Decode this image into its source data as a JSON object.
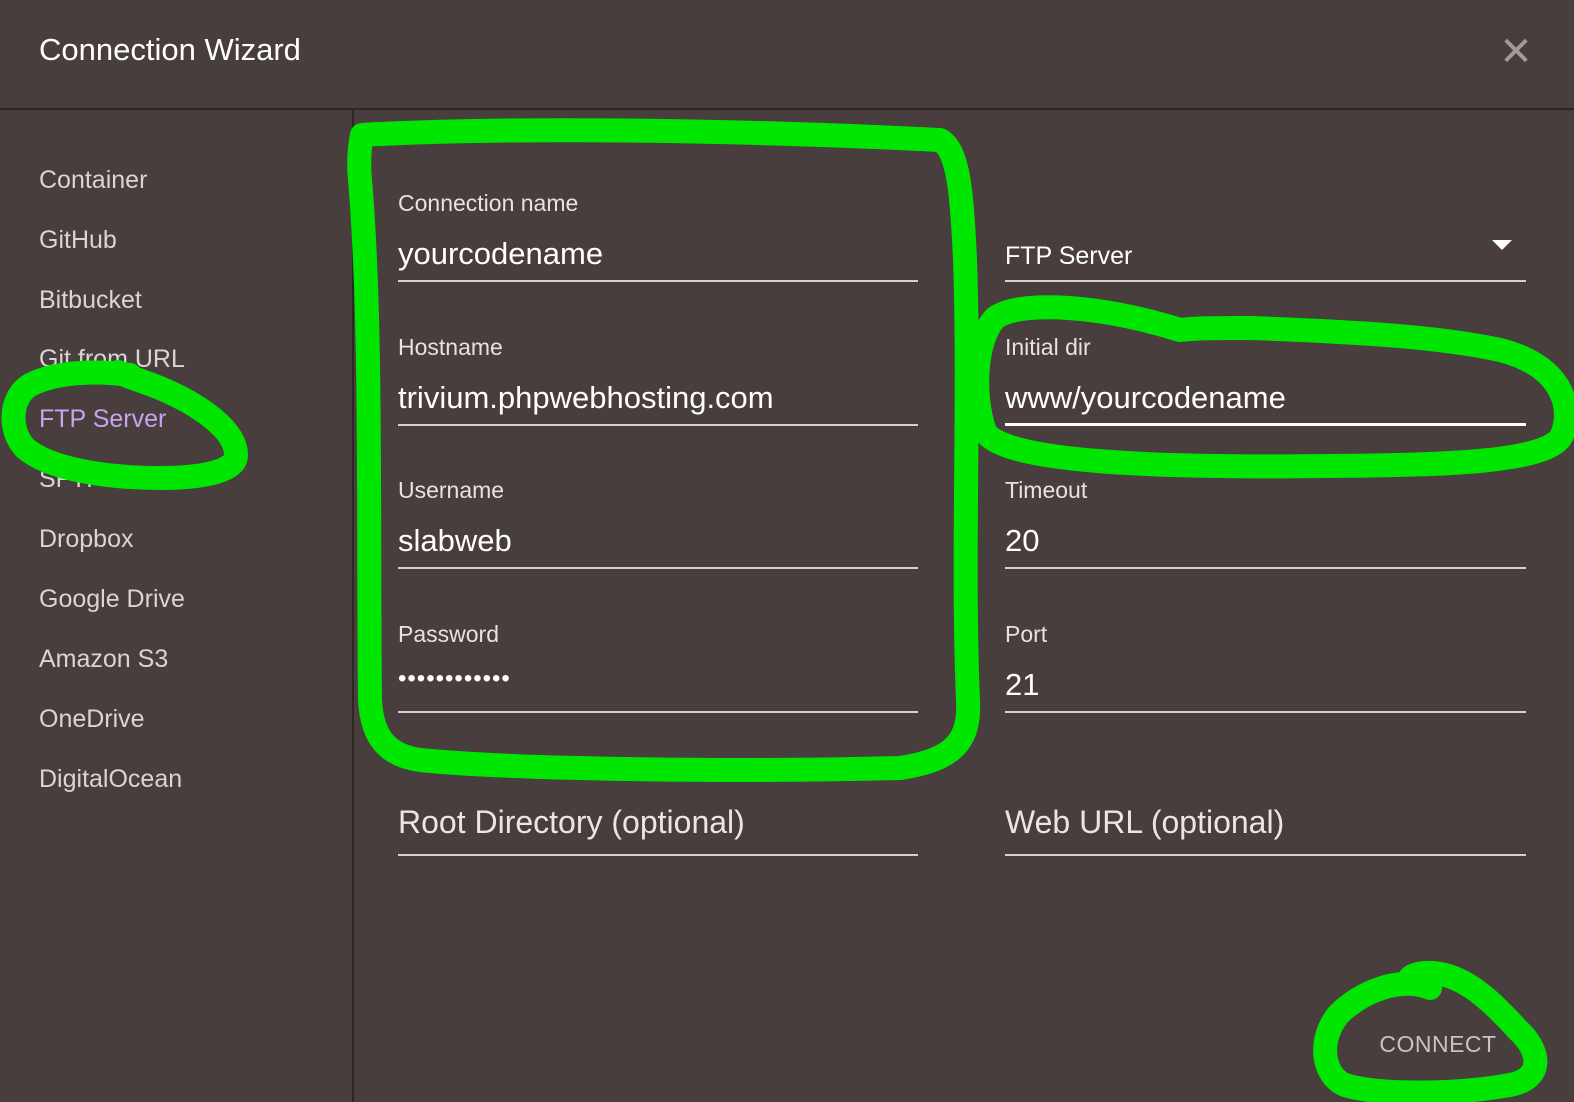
{
  "dialog": {
    "title": "Connection Wizard",
    "close_label": "✕"
  },
  "sidebar": {
    "items": [
      {
        "label": "Container"
      },
      {
        "label": "GitHub"
      },
      {
        "label": "Bitbucket"
      },
      {
        "label": "Git from URL"
      },
      {
        "label": "FTP Server",
        "active": true
      },
      {
        "label": "SFTP"
      },
      {
        "label": "Dropbox"
      },
      {
        "label": "Google Drive"
      },
      {
        "label": "Amazon S3"
      },
      {
        "label": "OneDrive"
      },
      {
        "label": "DigitalOcean"
      }
    ]
  },
  "form": {
    "connection_name": {
      "label": "Connection name",
      "value": "yourcodename"
    },
    "type_select": {
      "value": "FTP Server"
    },
    "hostname": {
      "label": "Hostname",
      "value": "trivium.phpwebhosting.com"
    },
    "initial_dir": {
      "label": "Initial dir",
      "value": "www/yourcodename"
    },
    "username": {
      "label": "Username",
      "value": "slabweb"
    },
    "timeout": {
      "label": "Timeout",
      "value": "20"
    },
    "password": {
      "label": "Password",
      "value": "••••••••••••"
    },
    "port": {
      "label": "Port",
      "value": "21"
    },
    "root_directory": {
      "placeholder": "Root Directory (optional)"
    },
    "web_url": {
      "placeholder": "Web URL (optional)"
    }
  },
  "actions": {
    "connect_label": "CONNECT"
  },
  "annotation_color": "#00e600"
}
